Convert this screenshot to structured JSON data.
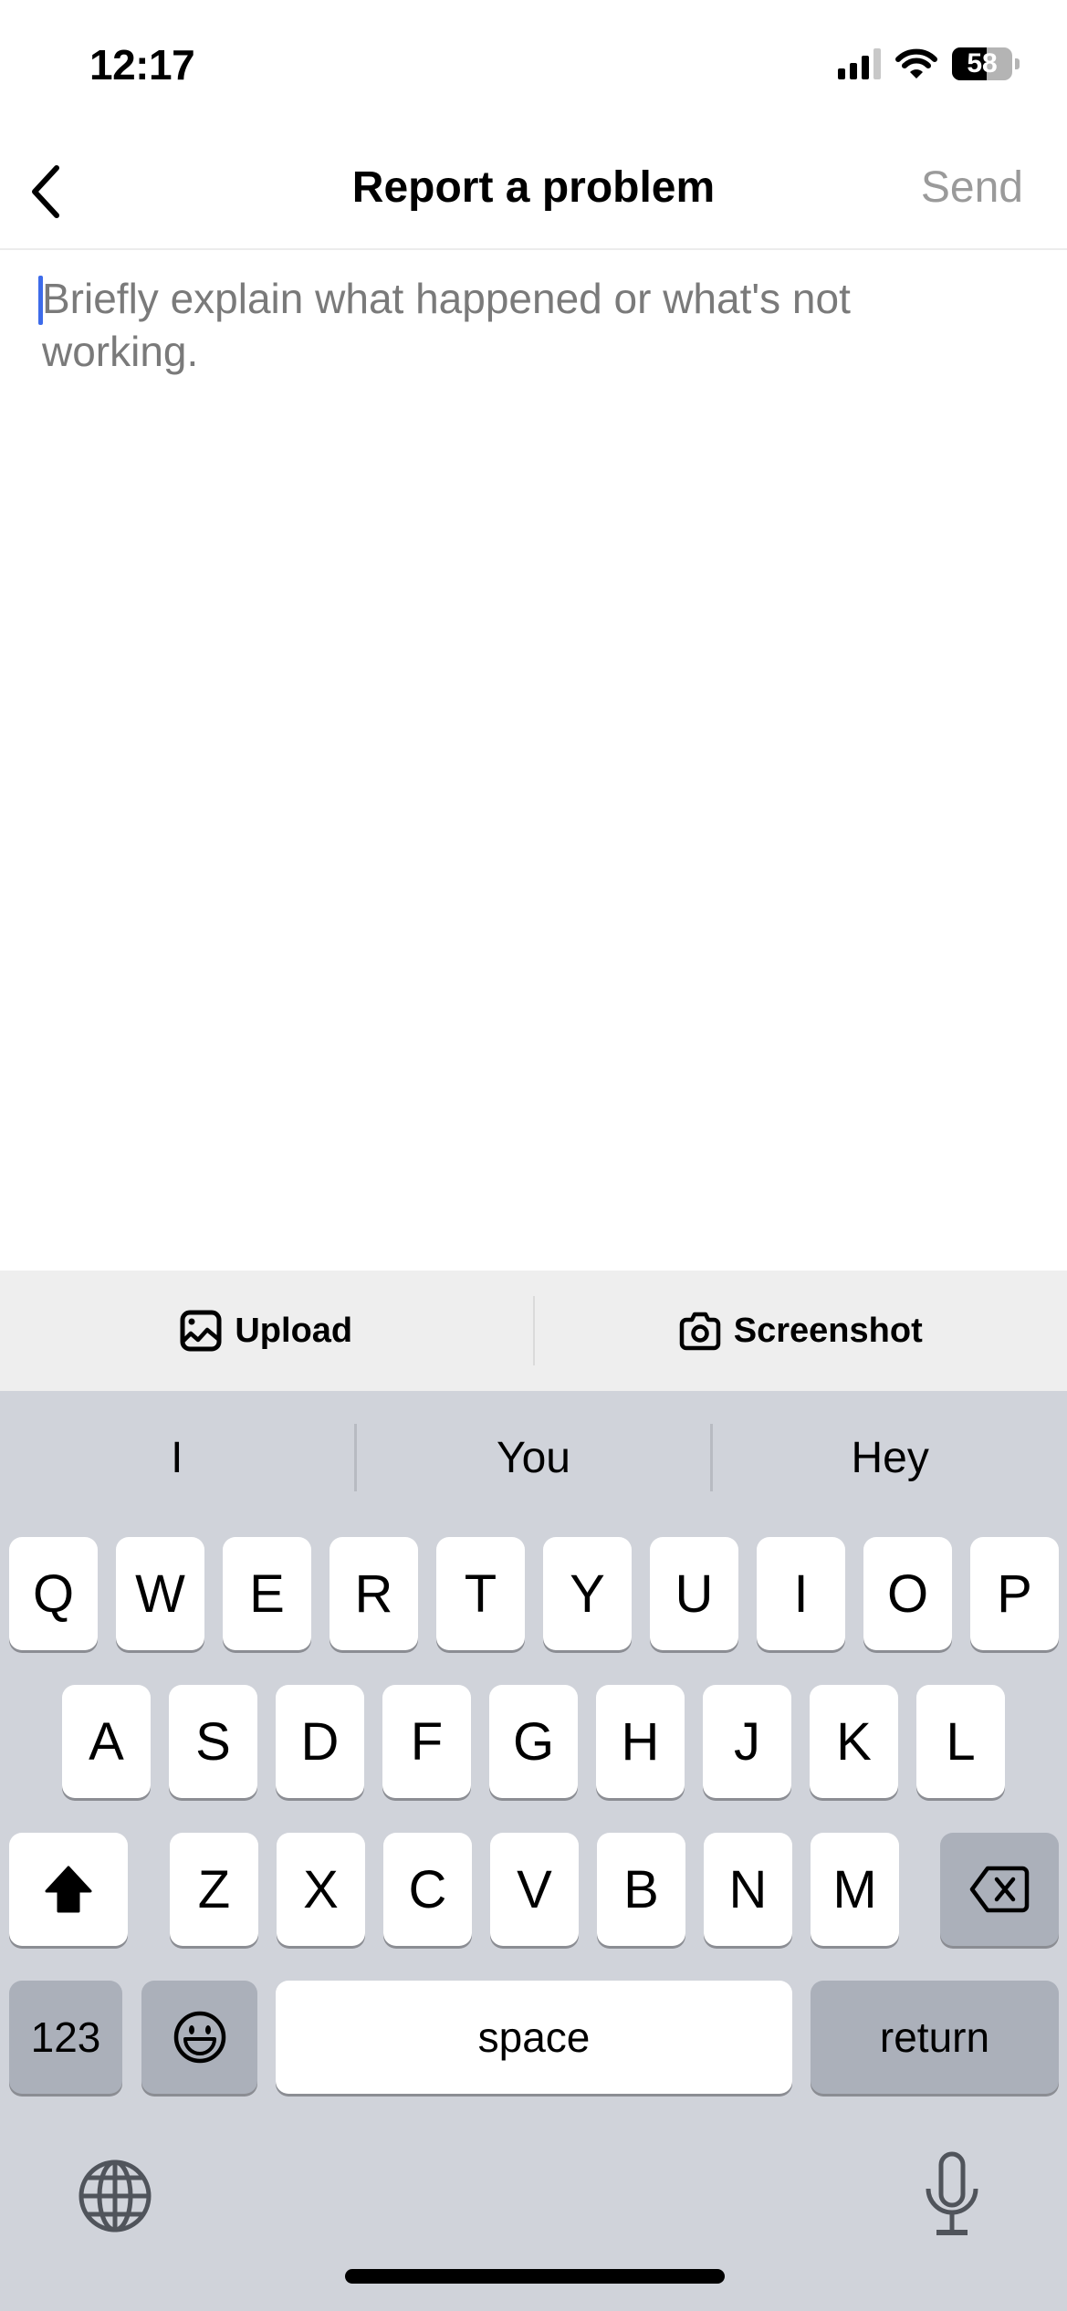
{
  "status_bar": {
    "time": "12:17",
    "battery_percent": "58",
    "battery_level": 0.58,
    "signal_bars_active": 3,
    "signal_bars_total": 4
  },
  "nav": {
    "title": "Report a problem",
    "send_label": "Send",
    "back_icon": "chevron-left-icon"
  },
  "editor": {
    "value": "",
    "placeholder": "Briefly explain what happened or what's not working."
  },
  "accessory": {
    "upload_label": "Upload",
    "upload_icon": "photo-icon",
    "screenshot_label": "Screenshot",
    "screenshot_icon": "camera-icon"
  },
  "keyboard": {
    "predictions": [
      "I",
      "You",
      "Hey"
    ],
    "row1": [
      "Q",
      "W",
      "E",
      "R",
      "T",
      "Y",
      "U",
      "I",
      "O",
      "P"
    ],
    "row2": [
      "A",
      "S",
      "D",
      "F",
      "G",
      "H",
      "J",
      "K",
      "L"
    ],
    "row3": [
      "Z",
      "X",
      "C",
      "V",
      "B",
      "N",
      "M"
    ],
    "numbers_label": "123",
    "space_label": "space",
    "return_label": "return",
    "shift_icon": "shift-icon",
    "delete_icon": "delete-icon",
    "emoji_icon": "emoji-icon",
    "globe_icon": "globe-icon",
    "mic_icon": "microphone-icon"
  },
  "colors": {
    "caret": "#3d6bea",
    "send_disabled": "#9a9a9a",
    "keyboard_bg": "#d0d3da",
    "accessory_bg": "#eeeeee"
  }
}
